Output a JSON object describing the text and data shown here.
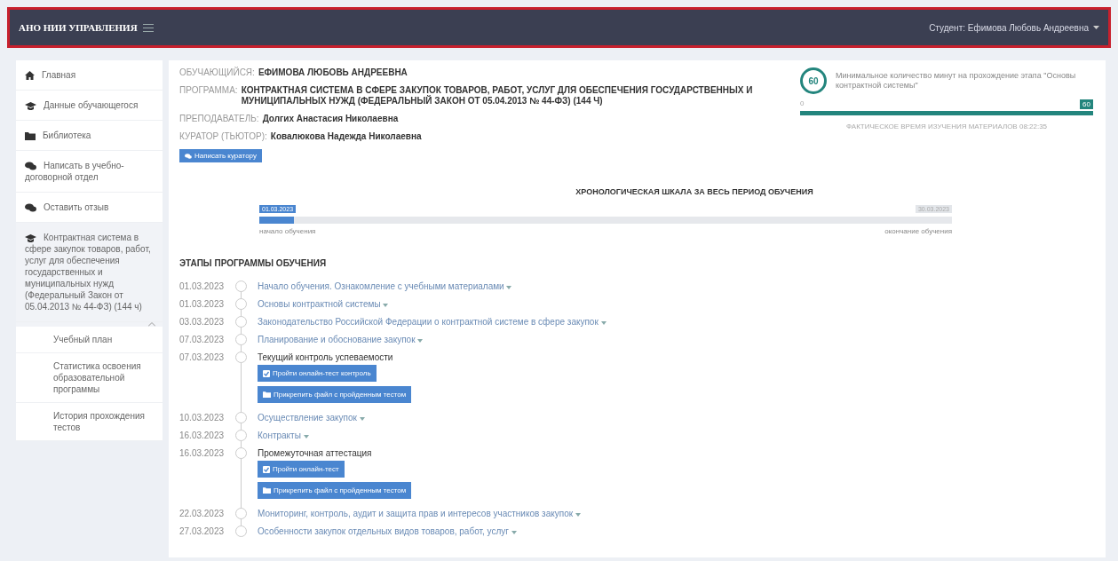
{
  "header": {
    "brand": "АНО НИИ УПРАВЛЕНИЯ",
    "user": "Студент: Ефимова Любовь Андреевна"
  },
  "sidebar": {
    "items": [
      {
        "label": "Главная",
        "kind": "home",
        "selected": false
      },
      {
        "label": "Данные обучающегося",
        "kind": "cap",
        "selected": false
      },
      {
        "label": "Библиотека",
        "kind": "folder",
        "selected": false
      },
      {
        "label": "Написать в учебно-договорной отдел",
        "kind": "chat",
        "selected": false
      },
      {
        "label": "Оставить отзыв",
        "kind": "chat",
        "selected": false
      },
      {
        "label": "Контрактная система в сфере закупок товаров, работ, услуг для обеспечения государственных и муниципальных нужд (Федеральный Закон от 05.04.2013 № 44-ФЗ) (144 ч)",
        "kind": "cap",
        "selected": true,
        "expanded": true,
        "children": [
          {
            "label": "Учебный план"
          },
          {
            "label": "Статистика освоения образовательной программы"
          },
          {
            "label": "История прохождения тестов"
          }
        ]
      }
    ]
  },
  "info": [
    {
      "label": "ОБУЧАЮЩИЙСЯ:",
      "value": "ЕФИМОВА ЛЮБОВЬ АНДРЕЕВНА"
    },
    {
      "label": "ПРОГРАММА:",
      "value": "КОНТРАКТНАЯ СИСТЕМА В СФЕРЕ ЗАКУПОК ТОВАРОВ, РАБОТ, УСЛУГ ДЛЯ ОБЕСПЕЧЕНИЯ ГОСУДАРСТВЕННЫХ И МУНИЦИПАЛЬНЫХ НУЖД (ФЕДЕРАЛЬНЫЙ ЗАКОН ОТ 05.04.2013 № 44-ФЗ) (144 Ч)"
    },
    {
      "label": "ПРЕПОДАВАТЕЛЬ:",
      "value": "Долгих Анастасия Николаевна"
    },
    {
      "label": "КУРАТОР (ТЬЮТОР):",
      "value": "Ковалюкова Надежда Николаевна"
    }
  ],
  "curator_button": "Написать куратору",
  "minutes": {
    "count": "60",
    "text": "Минимальное количество минут на прохождение этапа \"Основы контрактной системы\"",
    "min": "0",
    "max": "60",
    "level": 1,
    "actual": "ФАКТИЧЕСКОЕ ВРЕМЯ ИЗУЧЕНИЯ МАТЕРИАЛОВ 08:22:35"
  },
  "timeline": {
    "title": "ХРОНОЛОГИЧЕСКАЯ ШКАЛА ЗА ВЕСЬ ПЕРИОД ОБУЧЕНИЯ",
    "current": "01.03.2023",
    "end": "30.03.2023",
    "level": 0.05,
    "start_label": "начало обучения",
    "end_label": "окончание обучения"
  },
  "stages_title": "ЭТАПЫ ПРОГРАММЫ ОБУЧЕНИЯ",
  "stages": [
    {
      "date": "01.03.2023",
      "kind": "link",
      "title": "Начало обучения. Ознакомление с учебными материалами"
    },
    {
      "date": "01.03.2023",
      "kind": "link",
      "title": "Основы контрактной системы"
    },
    {
      "date": "03.03.2023",
      "kind": "link",
      "title": "Законодательство Российской Федерации о контрактной системе в сфере закупок"
    },
    {
      "date": "07.03.2023",
      "kind": "link",
      "title": "Планирование и обоснование закупок"
    },
    {
      "date": "07.03.2023",
      "kind": "test",
      "title": "Текущий контроль успеваемости",
      "buttons": [
        {
          "label": "Пройти онлайн-тест контроль",
          "kind": "check"
        },
        {
          "label": "Прикрепить файл с пройденным тестом",
          "kind": "folder"
        }
      ]
    },
    {
      "date": "10.03.2023",
      "kind": "link",
      "title": "Осуществление закупок"
    },
    {
      "date": "16.03.2023",
      "kind": "link",
      "title": "Контракты"
    },
    {
      "date": "16.03.2023",
      "kind": "test",
      "title": "Промежуточная аттестация",
      "buttons": [
        {
          "label": "Пройти онлайн-тест",
          "kind": "check"
        },
        {
          "label": "Прикрепить файл с пройденным тестом",
          "kind": "folder"
        }
      ]
    },
    {
      "date": "22.03.2023",
      "kind": "link",
      "title": "Мониторинг, контроль, аудит и защита прав и интересов участников закупок"
    },
    {
      "date": "27.03.2023",
      "kind": "link",
      "title": "Особенности закупок отдельных видов товаров, работ, услуг"
    }
  ]
}
